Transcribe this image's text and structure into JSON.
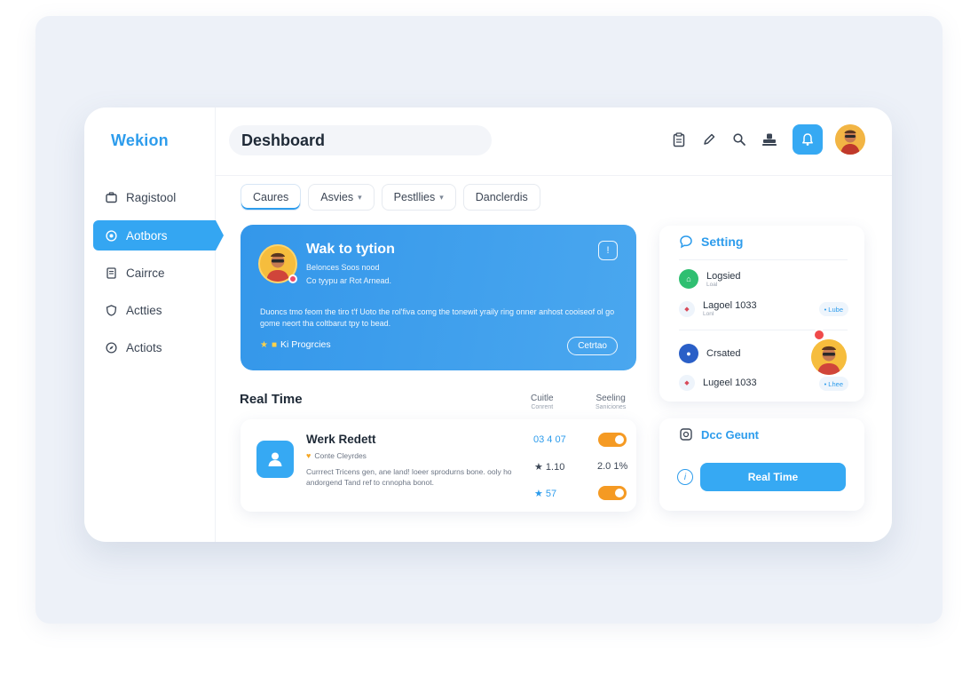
{
  "brand": {
    "logo": "Wekion"
  },
  "sidebar": {
    "items": [
      {
        "label": "Ragistool",
        "icon": "briefcase-icon"
      },
      {
        "label": "Aotbors",
        "icon": "target-icon"
      },
      {
        "label": "Cairrce",
        "icon": "document-icon"
      },
      {
        "label": "Actties",
        "icon": "shield-icon"
      },
      {
        "label": "Actiots",
        "icon": "compass-icon"
      }
    ],
    "active_index": 1
  },
  "header": {
    "search_value": "Deshboard",
    "icons": [
      "clipboard-icon",
      "pencil-icon",
      "search-icon",
      "stamp-icon"
    ],
    "notification_icon": "bell-icon",
    "avatar": "user-avatar"
  },
  "tabs": [
    {
      "label": "Caures",
      "dropdown": false
    },
    {
      "label": "Asvies",
      "dropdown": true
    },
    {
      "label": "Pestllies",
      "dropdown": true
    },
    {
      "label": "Danclerdis",
      "dropdown": false
    }
  ],
  "hero": {
    "title": "Wak to tytion",
    "subtitle1": "Belonces Soos nood",
    "subtitle2": "Co tyypu ar Rot Arnead.",
    "corner_icon": "info-icon",
    "description": "Duoncs tmo feom the tiro t'f Uoto the rol'fiva comg the tonewit yraily ring onner anhost cooiseof ol go gome neort tha coltbarut tpy to bead.",
    "progress": "Ki Progrcies",
    "button": "Cetrtao"
  },
  "realtime": {
    "title": "Real Time",
    "col1_title": "Cuitle",
    "col1_sub": "Conrent",
    "col2_title": "Seeling",
    "col2_sub": "Saniciones",
    "item": {
      "name": "Werk Redett",
      "tag": "Conte Cleyrdes",
      "description": "Currrect Tricens gen, ane land! loeer sprodurns bone. ooly ho andorgend Tand ref to cnnopha bonot.",
      "val1": "03 4 07",
      "val2": "★ 1.10",
      "val3": "2.0 1%",
      "val4": "★ 57"
    }
  },
  "settings": {
    "title": "Setting",
    "rows": [
      {
        "label": "Logsied",
        "sub": "Loal",
        "color": "#2fbf71"
      },
      {
        "label": "Lagoel 1033",
        "sub": "Lonl",
        "chip": "• Lube"
      },
      {
        "label": "Crsated",
        "sub": "",
        "color": "#2a5fc7"
      },
      {
        "label": "Lugeel 1033",
        "sub": "",
        "chip": "• Lhee"
      }
    ]
  },
  "doc": {
    "title": "Dcc Geunt",
    "button": "Real Time"
  },
  "colors": {
    "accent": "#34a6f2",
    "hero": "#3a9cec",
    "toggle": "#f59a23"
  }
}
